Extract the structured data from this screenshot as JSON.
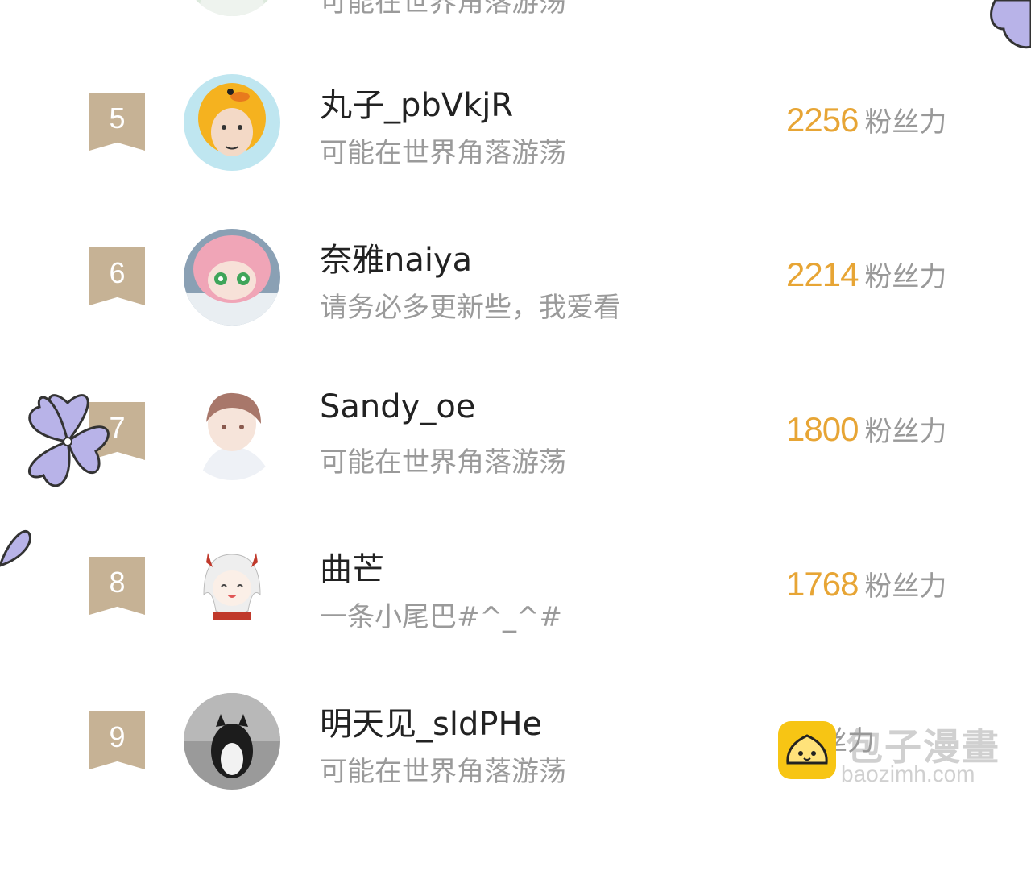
{
  "leaderboard": {
    "unit_label": "粉丝力",
    "partial_top": {
      "signature": "可能在世界角落游荡"
    },
    "entries": [
      {
        "rank": "5",
        "name": "丸子_pbVkjR",
        "signature": "可能在世界角落游荡",
        "score": "2256"
      },
      {
        "rank": "6",
        "name": "奈雅naiya",
        "signature": "请务必多更新些，我爱看",
        "score": "2214"
      },
      {
        "rank": "7",
        "name": "Sandy_oe",
        "signature": "可能在世界角落游荡",
        "score": "1800"
      },
      {
        "rank": "8",
        "name": "曲芒",
        "signature": "一条小尾巴#^_^#",
        "score": "1768"
      },
      {
        "rank": "9",
        "name": "明天见_sldPHe",
        "signature": "可能在世界角落游荡",
        "score": ""
      }
    ]
  },
  "watermark": {
    "title": "包子漫畫",
    "url": "baozimh.com"
  },
  "colors": {
    "rank_badge": "#c6b295",
    "score": "#e7a535",
    "muted_text": "#9a9a9a",
    "flower": "#b8b3e8"
  },
  "icons": [
    "flower-decoration-icon",
    "baozi-logo-icon"
  ]
}
